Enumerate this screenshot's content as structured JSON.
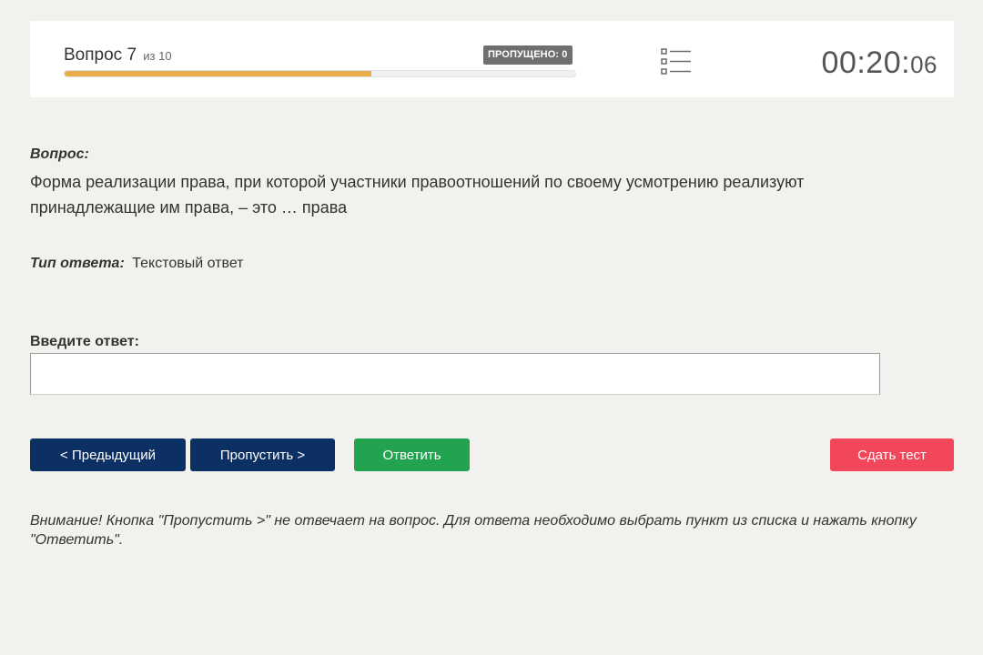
{
  "header": {
    "question_label": "Вопрос 7",
    "question_of": "из 10",
    "skipped_badge": "ПРОПУЩЕНО: 0",
    "progress_fraction": 0.6,
    "timer_main": "00:20:",
    "timer_seconds": "06",
    "list_icon": "list-icon",
    "progress_color": "#e8ad4a"
  },
  "question": {
    "label": "Вопрос:",
    "text": "Форма реализации права, при которой участники правоотношений по своему усмотрению реализуют принадлежащие им права, – это … права",
    "type_label": "Тип ответа:",
    "type_value": "Текстовый ответ"
  },
  "answer": {
    "label": "Введите ответ:",
    "value": ""
  },
  "buttons": {
    "prev": "< Предыдущий",
    "skip": "Пропустить >",
    "answer": "Ответить",
    "finish": "Сдать тест",
    "colors": {
      "nav": "#0c2f64",
      "answer": "#22a34f",
      "finish": "#f2465a"
    }
  },
  "note": "Внимание! Кнопка \"Пропустить >\" не отвечает на вопрос. Для ответа необходимо выбрать пункт из списка и нажать кнопку \"Ответить\"."
}
